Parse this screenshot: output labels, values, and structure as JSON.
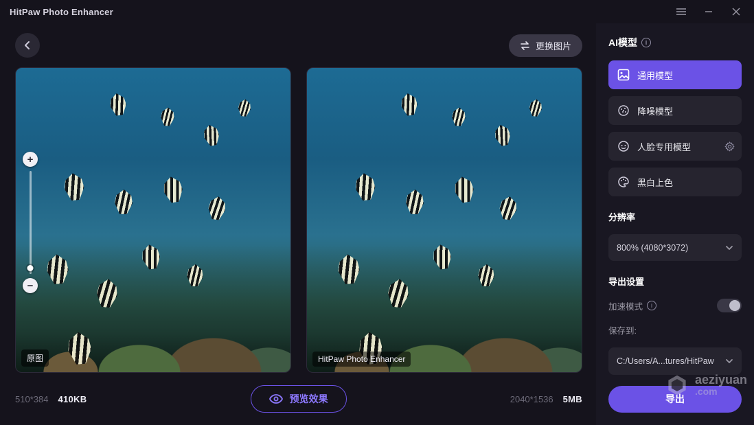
{
  "app": {
    "title": "HitPaw Photo Enhancer"
  },
  "toolbar": {
    "swap_label": "更换图片"
  },
  "original": {
    "badge": "原图",
    "resolution": "510*384",
    "filesize": "410KB"
  },
  "enhanced": {
    "badge": "HitPaw Photo Enhancer",
    "resolution": "2040*1536",
    "filesize": "5MB"
  },
  "preview_label": "预览效果",
  "side": {
    "ai_title": "AI模型",
    "models": {
      "general": "通用模型",
      "denoise": "降噪模型",
      "face": "人脸专用模型",
      "colorize": "黑白上色"
    },
    "resolution_title": "分辨率",
    "resolution_value": "800% (4080*3072)",
    "export_title": "导出设置",
    "accel_label": "加速模式",
    "saveto_label": "保存到:",
    "saveto_value": "C:/Users/A...tures/HitPaw",
    "export_button": "导出"
  },
  "watermark": {
    "line1": "aeziyuan",
    "line2": ".com"
  }
}
